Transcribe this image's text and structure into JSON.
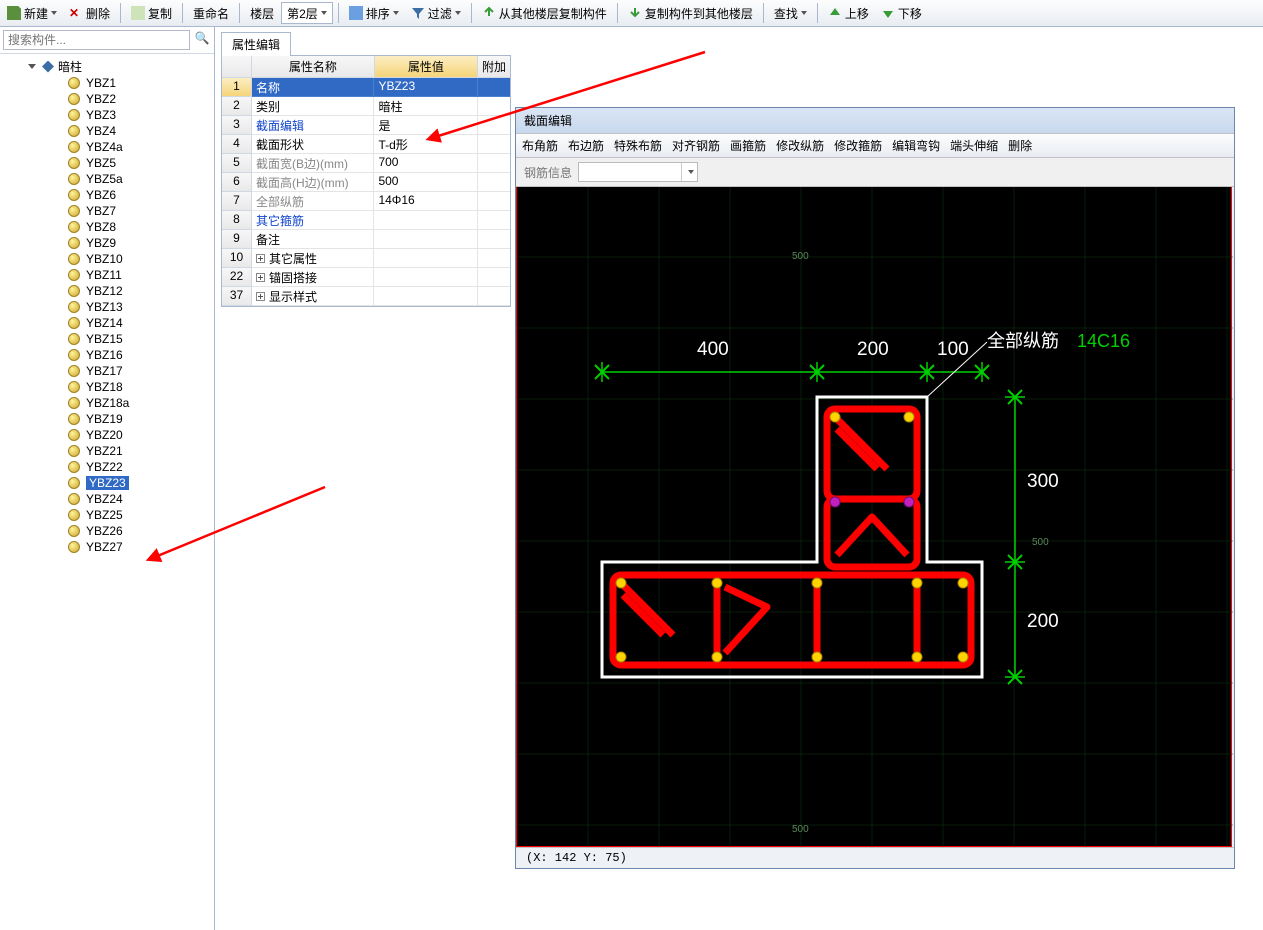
{
  "toolbar": {
    "new": "新建",
    "delete": "删除",
    "copy": "复制",
    "rename": "重命名",
    "floor_label": "楼层",
    "floor_value": "第2层",
    "sort": "排序",
    "filter": "过滤",
    "copy_from": "从其他楼层复制构件",
    "copy_to": "复制构件到其他楼层",
    "find": "查找",
    "up": "上移",
    "down": "下移"
  },
  "search_placeholder": "搜索构件...",
  "tree": {
    "root": "暗柱",
    "items": [
      "YBZ1",
      "YBZ2",
      "YBZ3",
      "YBZ4",
      "YBZ4a",
      "YBZ5",
      "YBZ5a",
      "YBZ6",
      "YBZ7",
      "YBZ8",
      "YBZ9",
      "YBZ10",
      "YBZ11",
      "YBZ12",
      "YBZ13",
      "YBZ14",
      "YBZ15",
      "YBZ16",
      "YBZ17",
      "YBZ18",
      "YBZ18a",
      "YBZ19",
      "YBZ20",
      "YBZ21",
      "YBZ22",
      "YBZ23",
      "YBZ24",
      "YBZ25",
      "YBZ26",
      "YBZ27"
    ],
    "selected": "YBZ23"
  },
  "attr": {
    "tab": "属性编辑",
    "head_name": "属性名称",
    "head_val": "属性值",
    "head_add": "附加",
    "rows": [
      {
        "n": "1",
        "name": "名称",
        "val": "YBZ23",
        "sel": true
      },
      {
        "n": "2",
        "name": "类别",
        "val": "暗柱"
      },
      {
        "n": "3",
        "name": "截面编辑",
        "val": "是",
        "blue": true
      },
      {
        "n": "4",
        "name": "截面形状",
        "val": "T-d形"
      },
      {
        "n": "5",
        "name": "截面宽(B边)(mm)",
        "val": "700",
        "gray": true
      },
      {
        "n": "6",
        "name": "截面高(H边)(mm)",
        "val": "500",
        "gray": true
      },
      {
        "n": "7",
        "name": "全部纵筋",
        "val": "14Φ16",
        "gray": true
      },
      {
        "n": "8",
        "name": "其它箍筋",
        "val": "",
        "blue": true
      },
      {
        "n": "9",
        "name": "备注",
        "val": ""
      },
      {
        "n": "10",
        "name": "其它属性",
        "val": "",
        "exp": true
      },
      {
        "n": "22",
        "name": "锚固搭接",
        "val": "",
        "exp": true
      },
      {
        "n": "37",
        "name": "显示样式",
        "val": "",
        "exp": true
      }
    ]
  },
  "section": {
    "title": "截面编辑",
    "tools": [
      "布角筋",
      "布边筋",
      "特殊布筋",
      "对齐钢筋",
      "画箍筋",
      "修改纵筋",
      "修改箍筋",
      "编辑弯钩",
      "端头伸缩",
      "删除"
    ],
    "info_label": "钢筋信息",
    "status": "(X: 142 Y: 75)",
    "annot_label": "全部纵筋",
    "annot_val": "14C16",
    "dims_top": [
      "400",
      "200",
      "100"
    ],
    "dims_right": [
      "300",
      "200"
    ],
    "ticks_top": "500",
    "ticks_right": "500",
    "ticks_bottom": "500"
  },
  "chart_data": {
    "type": "diagram",
    "component": "T-d形 暗柱 截面",
    "rebar_label": "全部纵筋",
    "rebar_spec": "14C16",
    "horizontal_dims_mm": [
      400,
      200,
      100
    ],
    "vertical_dims_mm": [
      300,
      200
    ],
    "total_width_mm": 700,
    "total_height_mm": 500
  }
}
